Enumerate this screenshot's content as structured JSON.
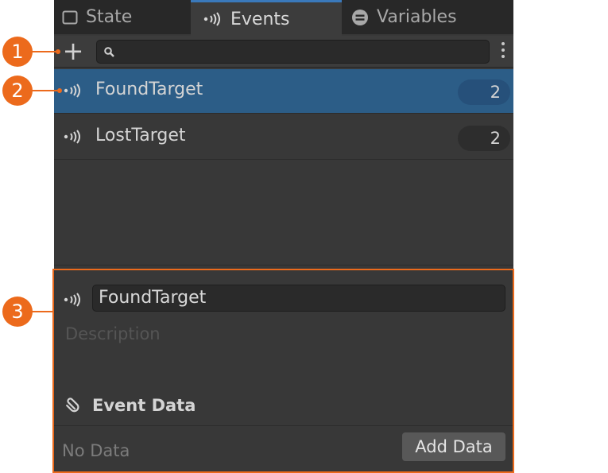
{
  "tabs": [
    {
      "label": "State",
      "icon": "square-outline-icon",
      "active": false
    },
    {
      "label": "Events",
      "icon": "signal-icon",
      "active": true
    },
    {
      "label": "Variables",
      "icon": "variables-icon",
      "active": false
    }
  ],
  "toolbar": {
    "add_label": "+",
    "search_value": ""
  },
  "events": [
    {
      "name": "FoundTarget",
      "count": "2",
      "selected": true
    },
    {
      "name": "LostTarget",
      "count": "2",
      "selected": false
    }
  ],
  "detail": {
    "name_value": "FoundTarget",
    "description_placeholder": "Description",
    "data_heading": "Event Data",
    "no_data": "No Data",
    "add_data_label": "Add Data"
  },
  "callouts": [
    "1",
    "2",
    "3"
  ],
  "colors": {
    "accent": "#ec6a1c",
    "selection": "#2c5d87",
    "tab_indicator": "#3a79bb",
    "panel_bg": "#383838"
  }
}
